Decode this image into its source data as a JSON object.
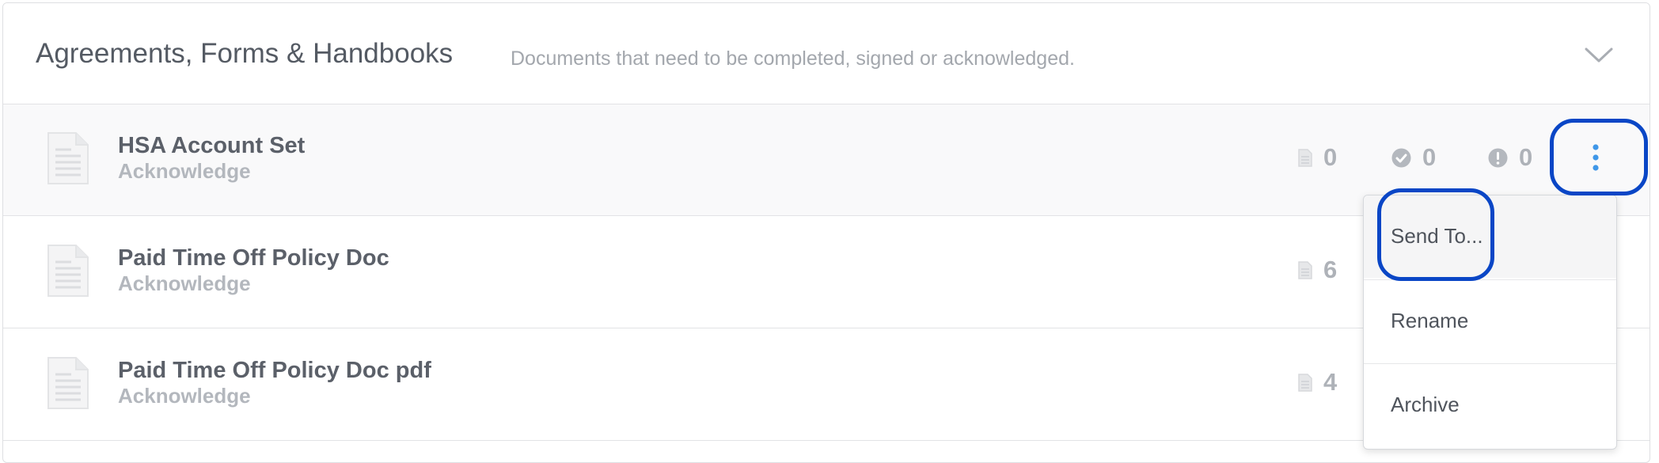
{
  "section": {
    "title": "Agreements, Forms & Handbooks",
    "subtitle": "Documents that need to be completed, signed or acknowledged.",
    "collapse_icon": "chevron-down-icon"
  },
  "documents": [
    {
      "title": "HSA Account Set",
      "type": "Acknowledge",
      "files": "0",
      "completed": "0",
      "pending": "0"
    },
    {
      "title": "Paid Time Off Policy Doc",
      "type": "Acknowledge",
      "files": "6"
    },
    {
      "title": "Paid Time Off Policy Doc pdf",
      "type": "Acknowledge",
      "files": "4"
    }
  ],
  "menu": {
    "items": [
      "Send To...",
      "Rename",
      "Archive"
    ]
  },
  "colors": {
    "highlight": "#0a46c6",
    "kebab": "#3f97e8",
    "muted": "#aeb2b8"
  }
}
